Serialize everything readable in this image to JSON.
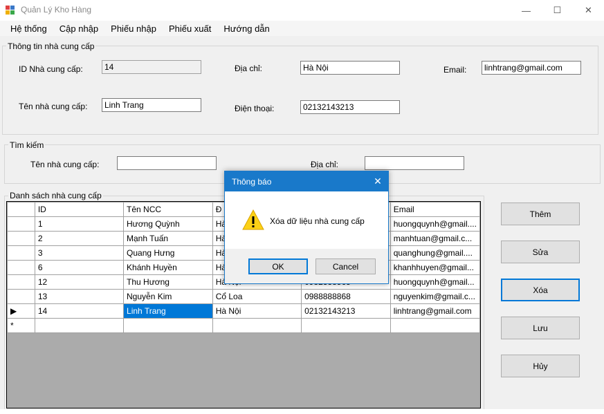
{
  "window": {
    "title": "Quản Lý Kho Hàng",
    "minimize": "—",
    "maximize": "☐",
    "close": "✕"
  },
  "menu": [
    "Hệ thống",
    "Cập nhập",
    "Phiếu nhập",
    "Phiếu xuất",
    "Hướng dẫn"
  ],
  "info": {
    "legend": "Thông tin nhà cung cấp",
    "id_label": "ID Nhà cung cấp:",
    "id_value": "14",
    "name_label": "Tên nhà cung cấp:",
    "name_value": "Linh Trang",
    "address_label": "Địa chỉ:",
    "address_value": "Hà Nội",
    "phone_label": "Điện thoại:",
    "phone_value": "02132143213",
    "email_label": "Email:",
    "email_value": "linhtrang@gmail.com"
  },
  "search": {
    "legend": "Tìm kiếm",
    "name_label": "Tên nhà cung cấp:",
    "name_value": "",
    "address_label": "Địa chỉ:",
    "address_value": ""
  },
  "list": {
    "legend": "Danh sách nhà cung cấp",
    "columns": [
      "ID",
      "Tên NCC",
      "Đ",
      "",
      "Email"
    ],
    "rows": [
      [
        "1",
        "Hương Quỳnh",
        "Hà",
        "",
        "huongquynh@gmail...."
      ],
      [
        "2",
        "Mạnh Tuấn",
        "Hà",
        "",
        "manhtuan@gmail.c..."
      ],
      [
        "3",
        "Quang Hưng",
        "Hà",
        "",
        "quanghung@gmail...."
      ],
      [
        "6",
        "Khánh Huyền",
        "Hà",
        "",
        "khanhhuyen@gmail..."
      ],
      [
        "12",
        "Thu Hương",
        "Hà Nội",
        "0982338565",
        "huongquynh@gmail..."
      ],
      [
        "13",
        "Nguyễn Kim",
        "Cổ Loa",
        "0988888868",
        "nguyenkim@gmail.c..."
      ],
      [
        "14",
        "Linh Trang",
        "Hà Nội",
        "02132143213",
        "linhtrang@gmail.com"
      ]
    ],
    "current_marker": "▶",
    "new_marker": "*"
  },
  "buttons": {
    "add": "Thêm",
    "edit": "Sửa",
    "delete": "Xóa",
    "save": "Lưu",
    "cancel": "Hủy"
  },
  "dialog": {
    "title": "Thông báo",
    "close": "✕",
    "message": "Xóa dữ liệu nhà cung cấp",
    "ok": "OK",
    "cancel": "Cancel"
  }
}
